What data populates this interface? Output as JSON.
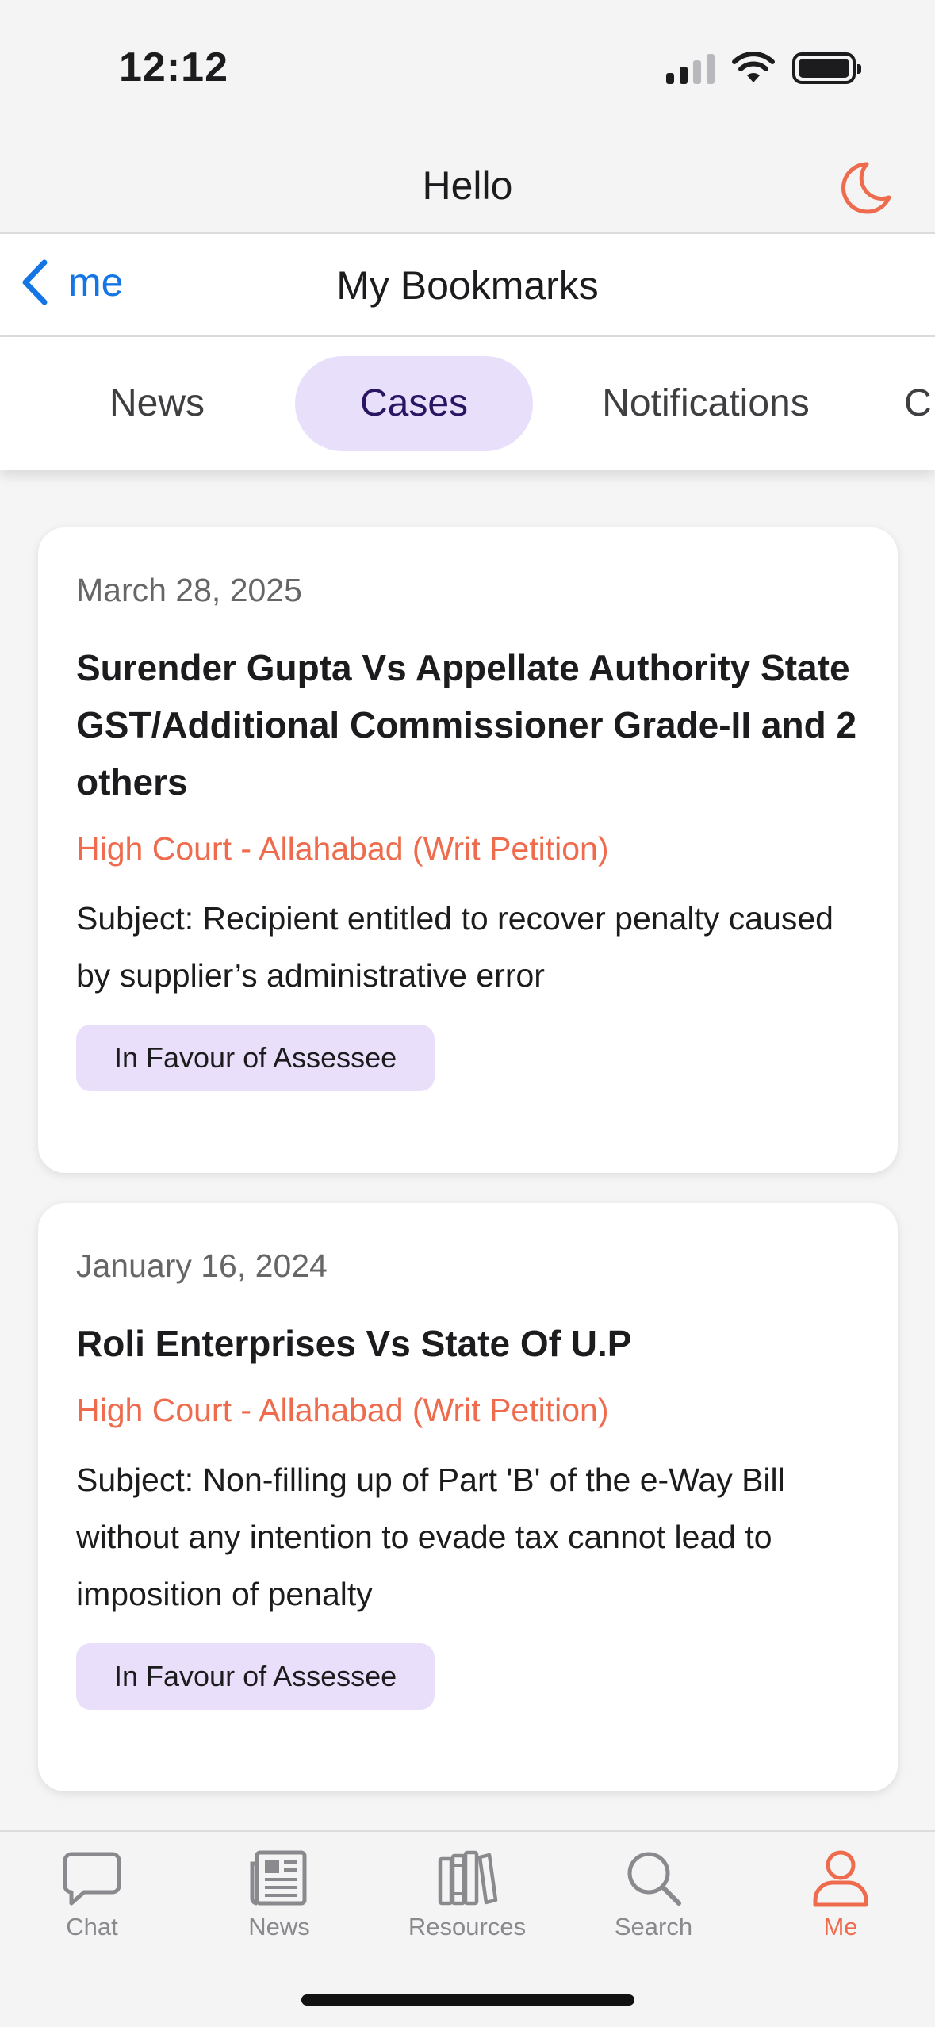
{
  "status_bar": {
    "time": "12:12"
  },
  "header": {
    "title": "Hello",
    "theme_icon": "moon-icon",
    "accent": "#ef6b4d"
  },
  "nav": {
    "back_label": "me",
    "title": "My Bookmarks"
  },
  "tabs": [
    {
      "label": "News",
      "active": false
    },
    {
      "label": "Cases",
      "active": true
    },
    {
      "label": "Notifications",
      "active": false
    },
    {
      "label": "C",
      "active": false
    }
  ],
  "cases": [
    {
      "date": "March 28, 2025",
      "title": "Surender Gupta Vs Appellate Authority State GST/Additional Commissioner Grade-II and 2 others",
      "court": "High Court - Allahabad (Writ Petition)",
      "subject": "Subject: Recipient entitled to recover penalty caused by supplier’s administrative error",
      "badge": "In Favour of Assessee"
    },
    {
      "date": "January 16, 2024",
      "title": "Roli Enterprises Vs State Of U.P",
      "court": "High Court - Allahabad (Writ Petition)",
      "subject": "Subject: Non-filling up of Part 'B' of the e-Way Bill without any intention to evade tax cannot lead to imposition of penalty",
      "badge": "In Favour of Assessee"
    }
  ],
  "tab_bar": [
    {
      "label": "Chat",
      "icon": "chat-icon",
      "active": false
    },
    {
      "label": "News",
      "icon": "newspaper-icon",
      "active": false
    },
    {
      "label": "Resources",
      "icon": "books-icon",
      "active": false
    },
    {
      "label": "Search",
      "icon": "search-icon",
      "active": false
    },
    {
      "label": "Me",
      "icon": "person-icon",
      "active": true
    }
  ]
}
